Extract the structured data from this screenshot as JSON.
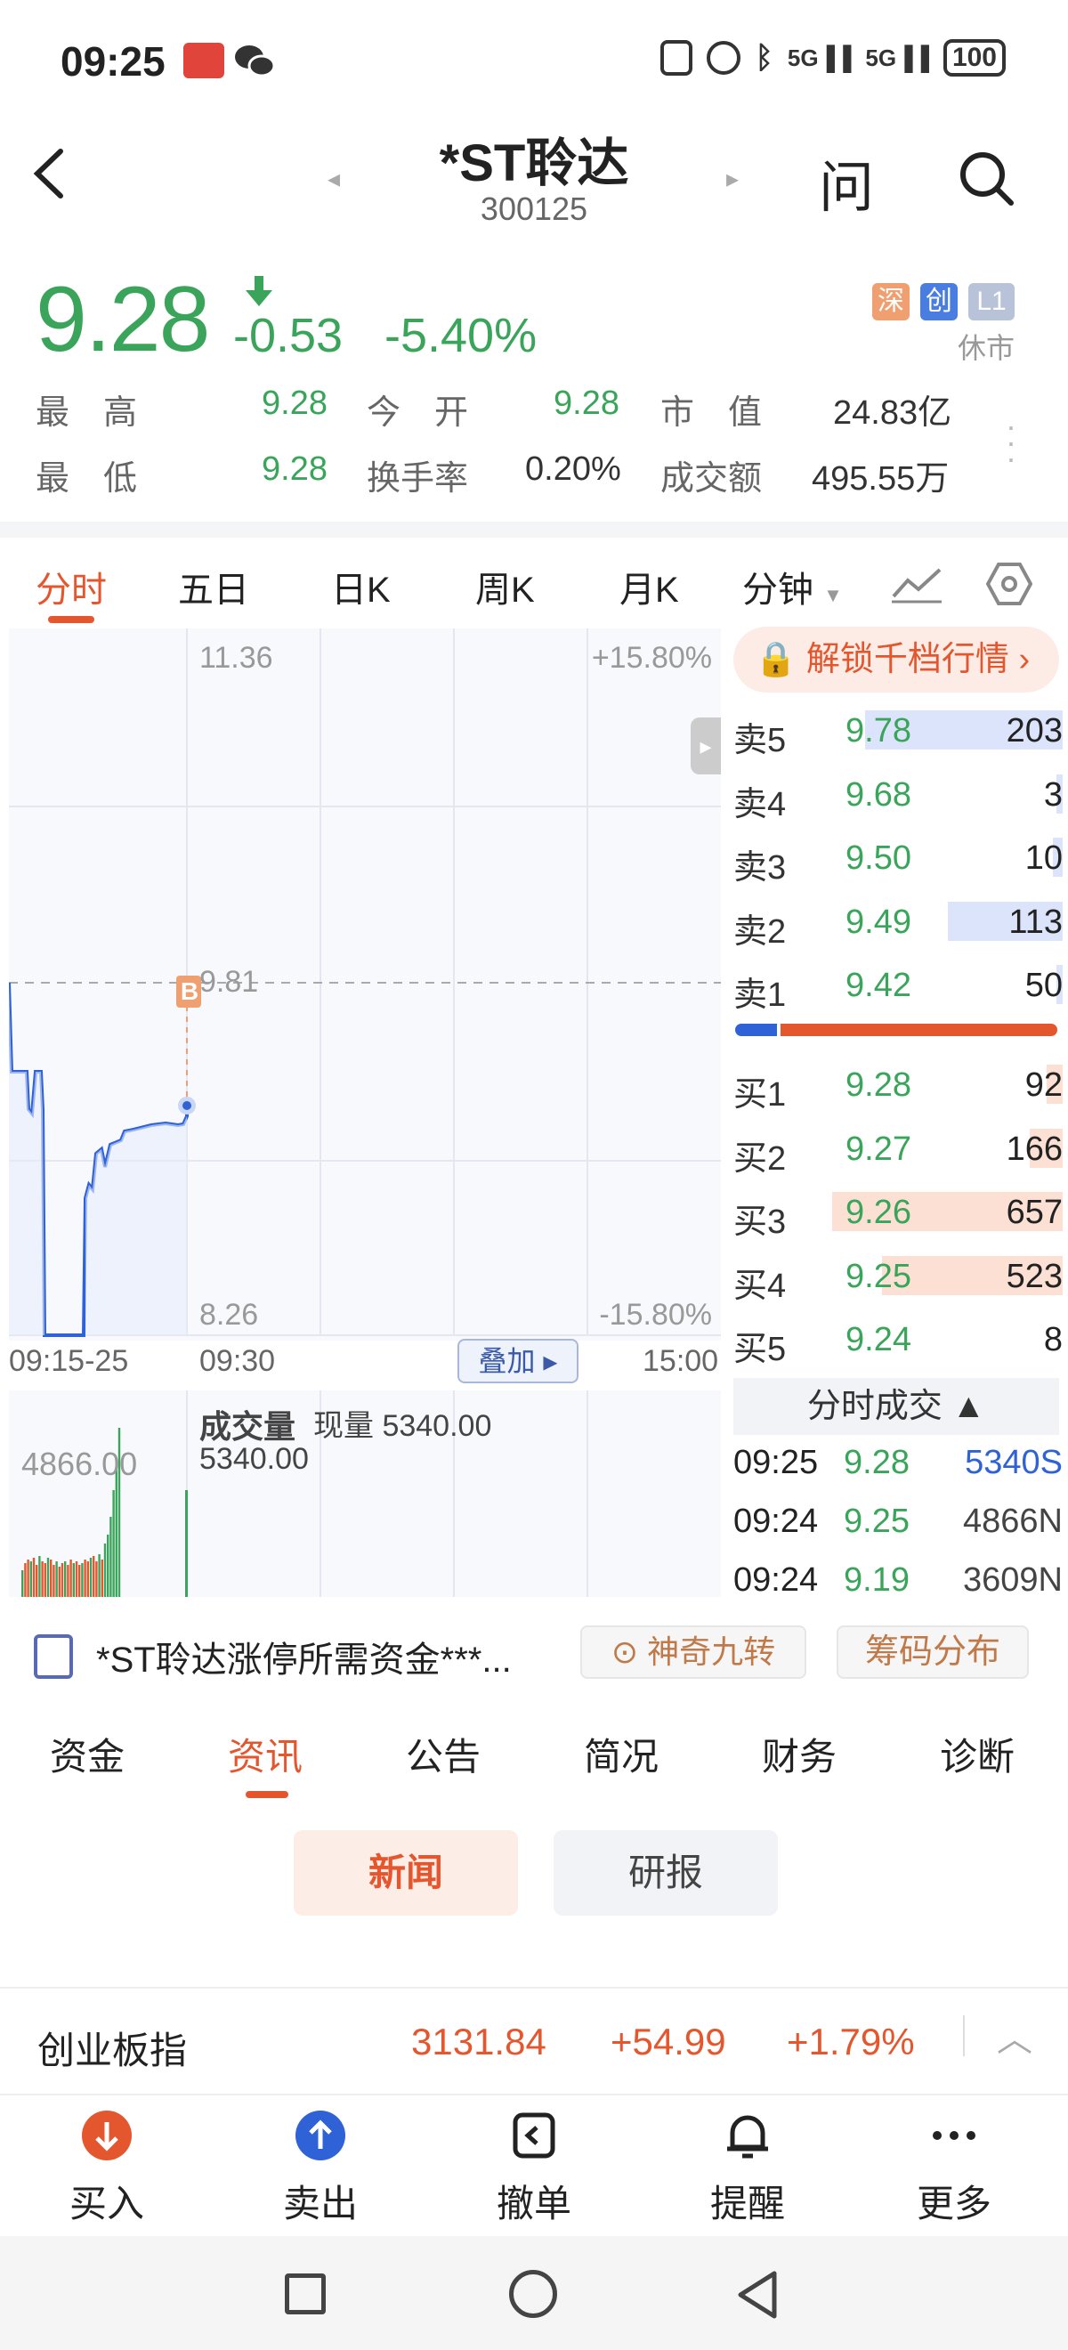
{
  "status_bar": {
    "time": "09:25",
    "battery": "100"
  },
  "header": {
    "title": "*ST聆达",
    "code": "300125",
    "ask_label": "问"
  },
  "quote": {
    "price": "9.28",
    "change": "-0.53",
    "change_pct": "-5.40%",
    "badges": [
      "深",
      "创",
      "L1"
    ],
    "market_status": "休市",
    "stats": [
      {
        "label": "最　高",
        "value": "9.28"
      },
      {
        "label": "今　开",
        "value": "9.28"
      },
      {
        "label": "市　值",
        "value": "24.83亿"
      },
      {
        "label": "最　低",
        "value": "9.28"
      },
      {
        "label": "换手率",
        "value": "0.20%"
      },
      {
        "label": "成交额",
        "value": "495.55万"
      }
    ]
  },
  "chart_tabs": [
    "分时",
    "五日",
    "日K",
    "周K",
    "月K",
    "分钟"
  ],
  "chart": {
    "y_top": "11.36",
    "y_mid": "9.81",
    "y_bottom": "8.26",
    "pct_top": "+15.80%",
    "pct_bottom": "-15.80%",
    "x_labels": [
      "09:15-25",
      "09:30",
      "15:00"
    ],
    "overlay_button": "叠加",
    "marker": "B",
    "volume_title": "成交量",
    "volume_now": "现量 5340.00",
    "volume_value": "5340.00",
    "volume_max": "4866.00"
  },
  "order_book": {
    "unlock_label": "解锁千档行情",
    "asks": [
      {
        "label": "卖5",
        "price": "9.78",
        "qty": "203",
        "bar": 0.6
      },
      {
        "label": "卖4",
        "price": "9.68",
        "qty": "3",
        "bar": 0.02
      },
      {
        "label": "卖3",
        "price": "9.50",
        "qty": "10",
        "bar": 0.03
      },
      {
        "label": "卖2",
        "price": "9.49",
        "qty": "113",
        "bar": 0.35
      },
      {
        "label": "卖1",
        "price": "9.42",
        "qty": "50",
        "bar": 0.02
      }
    ],
    "bids": [
      {
        "label": "买1",
        "price": "9.28",
        "qty": "92",
        "bar": 0.05
      },
      {
        "label": "买2",
        "price": "9.27",
        "qty": "166",
        "bar": 0.1
      },
      {
        "label": "买3",
        "price": "9.26",
        "qty": "657",
        "bar": 0.7
      },
      {
        "label": "买4",
        "price": "9.25",
        "qty": "523",
        "bar": 0.55
      },
      {
        "label": "买5",
        "price": "9.24",
        "qty": "8",
        "bar": 0.0
      }
    ],
    "tick_header": "分时成交",
    "ticks": [
      {
        "time": "09:25",
        "price": "9.28",
        "vol": "5340S"
      },
      {
        "time": "09:24",
        "price": "9.25",
        "vol": "4866N"
      },
      {
        "time": "09:24",
        "price": "9.19",
        "vol": "3609N"
      }
    ]
  },
  "news_line": {
    "text": "*ST聆达涨停所需资金***...",
    "magic_label": "神奇九转",
    "chip_label": "筹码分布"
  },
  "info_tabs": [
    "资金",
    "资讯",
    "公告",
    "简况",
    "财务",
    "诊断"
  ],
  "sub_tabs": [
    "新闻",
    "研报"
  ],
  "index_bar": {
    "name": "创业板指",
    "value": "3131.84",
    "change": "+54.99",
    "pct": "+1.79%"
  },
  "actions": [
    "买入",
    "卖出",
    "撤单",
    "提醒",
    "更多"
  ],
  "colors": {
    "up": "#e4572e",
    "down": "#3aa55a",
    "line": "#2f62d6"
  }
}
